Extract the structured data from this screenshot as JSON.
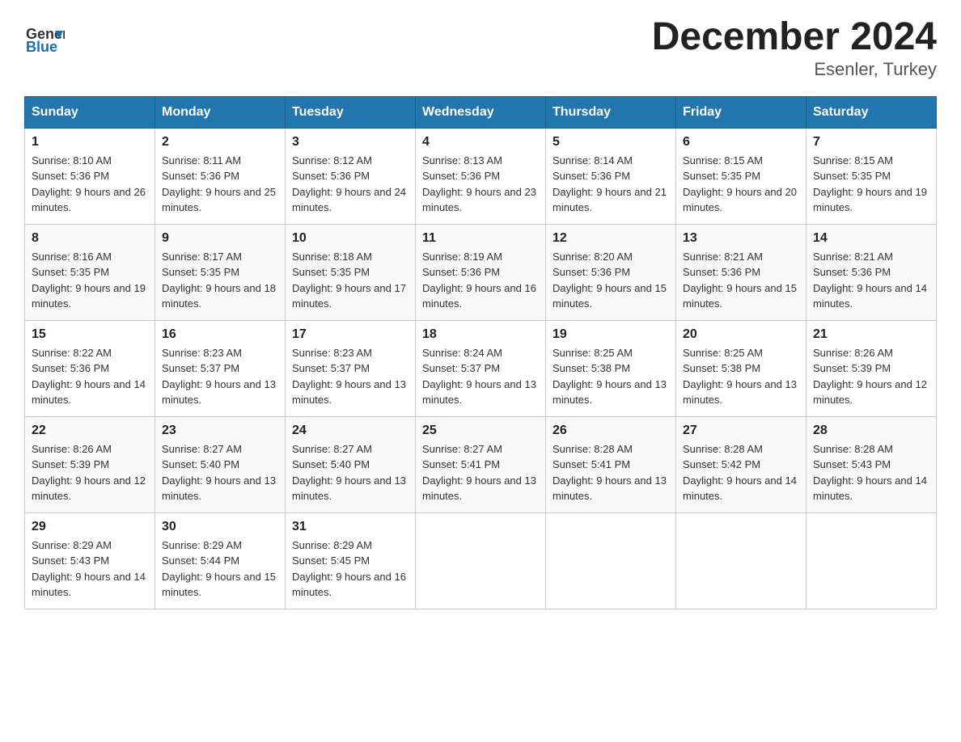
{
  "header": {
    "logo_general": "General",
    "logo_blue": "Blue",
    "title": "December 2024",
    "subtitle": "Esenler, Turkey"
  },
  "days_header": [
    "Sunday",
    "Monday",
    "Tuesday",
    "Wednesday",
    "Thursday",
    "Friday",
    "Saturday"
  ],
  "weeks": [
    [
      {
        "date": "1",
        "sunrise": "8:10 AM",
        "sunset": "5:36 PM",
        "daylight": "9 hours and 26 minutes."
      },
      {
        "date": "2",
        "sunrise": "8:11 AM",
        "sunset": "5:36 PM",
        "daylight": "9 hours and 25 minutes."
      },
      {
        "date": "3",
        "sunrise": "8:12 AM",
        "sunset": "5:36 PM",
        "daylight": "9 hours and 24 minutes."
      },
      {
        "date": "4",
        "sunrise": "8:13 AM",
        "sunset": "5:36 PM",
        "daylight": "9 hours and 23 minutes."
      },
      {
        "date": "5",
        "sunrise": "8:14 AM",
        "sunset": "5:36 PM",
        "daylight": "9 hours and 21 minutes."
      },
      {
        "date": "6",
        "sunrise": "8:15 AM",
        "sunset": "5:35 PM",
        "daylight": "9 hours and 20 minutes."
      },
      {
        "date": "7",
        "sunrise": "8:15 AM",
        "sunset": "5:35 PM",
        "daylight": "9 hours and 19 minutes."
      }
    ],
    [
      {
        "date": "8",
        "sunrise": "8:16 AM",
        "sunset": "5:35 PM",
        "daylight": "9 hours and 19 minutes."
      },
      {
        "date": "9",
        "sunrise": "8:17 AM",
        "sunset": "5:35 PM",
        "daylight": "9 hours and 18 minutes."
      },
      {
        "date": "10",
        "sunrise": "8:18 AM",
        "sunset": "5:35 PM",
        "daylight": "9 hours and 17 minutes."
      },
      {
        "date": "11",
        "sunrise": "8:19 AM",
        "sunset": "5:36 PM",
        "daylight": "9 hours and 16 minutes."
      },
      {
        "date": "12",
        "sunrise": "8:20 AM",
        "sunset": "5:36 PM",
        "daylight": "9 hours and 15 minutes."
      },
      {
        "date": "13",
        "sunrise": "8:21 AM",
        "sunset": "5:36 PM",
        "daylight": "9 hours and 15 minutes."
      },
      {
        "date": "14",
        "sunrise": "8:21 AM",
        "sunset": "5:36 PM",
        "daylight": "9 hours and 14 minutes."
      }
    ],
    [
      {
        "date": "15",
        "sunrise": "8:22 AM",
        "sunset": "5:36 PM",
        "daylight": "9 hours and 14 minutes."
      },
      {
        "date": "16",
        "sunrise": "8:23 AM",
        "sunset": "5:37 PM",
        "daylight": "9 hours and 13 minutes."
      },
      {
        "date": "17",
        "sunrise": "8:23 AM",
        "sunset": "5:37 PM",
        "daylight": "9 hours and 13 minutes."
      },
      {
        "date": "18",
        "sunrise": "8:24 AM",
        "sunset": "5:37 PM",
        "daylight": "9 hours and 13 minutes."
      },
      {
        "date": "19",
        "sunrise": "8:25 AM",
        "sunset": "5:38 PM",
        "daylight": "9 hours and 13 minutes."
      },
      {
        "date": "20",
        "sunrise": "8:25 AM",
        "sunset": "5:38 PM",
        "daylight": "9 hours and 13 minutes."
      },
      {
        "date": "21",
        "sunrise": "8:26 AM",
        "sunset": "5:39 PM",
        "daylight": "9 hours and 12 minutes."
      }
    ],
    [
      {
        "date": "22",
        "sunrise": "8:26 AM",
        "sunset": "5:39 PM",
        "daylight": "9 hours and 12 minutes."
      },
      {
        "date": "23",
        "sunrise": "8:27 AM",
        "sunset": "5:40 PM",
        "daylight": "9 hours and 13 minutes."
      },
      {
        "date": "24",
        "sunrise": "8:27 AM",
        "sunset": "5:40 PM",
        "daylight": "9 hours and 13 minutes."
      },
      {
        "date": "25",
        "sunrise": "8:27 AM",
        "sunset": "5:41 PM",
        "daylight": "9 hours and 13 minutes."
      },
      {
        "date": "26",
        "sunrise": "8:28 AM",
        "sunset": "5:41 PM",
        "daylight": "9 hours and 13 minutes."
      },
      {
        "date": "27",
        "sunrise": "8:28 AM",
        "sunset": "5:42 PM",
        "daylight": "9 hours and 14 minutes."
      },
      {
        "date": "28",
        "sunrise": "8:28 AM",
        "sunset": "5:43 PM",
        "daylight": "9 hours and 14 minutes."
      }
    ],
    [
      {
        "date": "29",
        "sunrise": "8:29 AM",
        "sunset": "5:43 PM",
        "daylight": "9 hours and 14 minutes."
      },
      {
        "date": "30",
        "sunrise": "8:29 AM",
        "sunset": "5:44 PM",
        "daylight": "9 hours and 15 minutes."
      },
      {
        "date": "31",
        "sunrise": "8:29 AM",
        "sunset": "5:45 PM",
        "daylight": "9 hours and 16 minutes."
      },
      null,
      null,
      null,
      null
    ]
  ]
}
